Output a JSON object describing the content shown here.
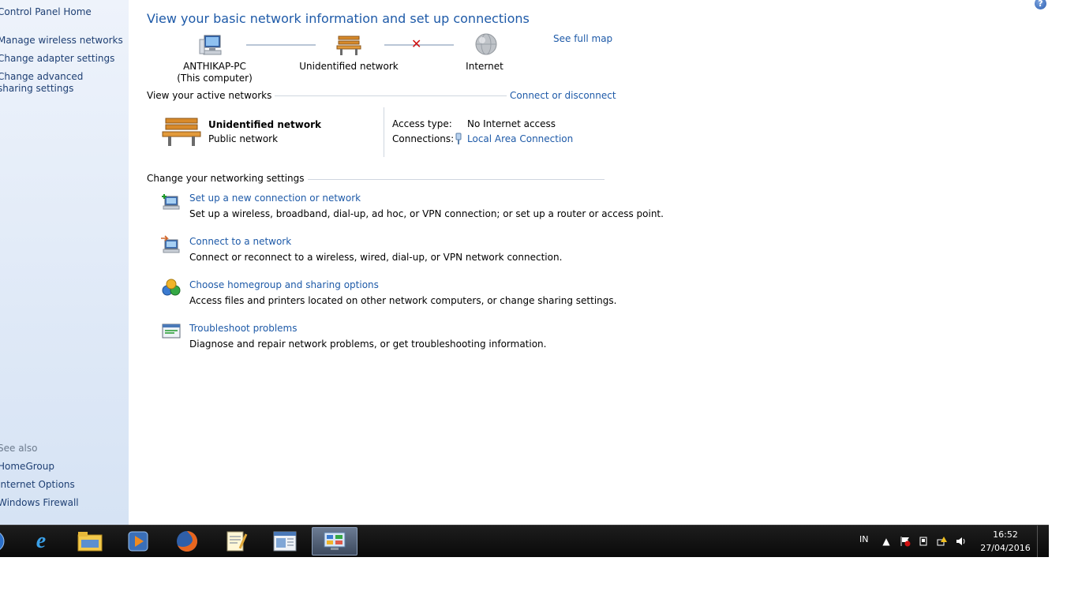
{
  "sidebar": {
    "home": "Control Panel Home",
    "items": [
      "Manage wireless networks",
      "Change adapter settings",
      "Change advanced sharing settings"
    ],
    "see_also_heading": "See also",
    "see_also": [
      "HomeGroup",
      "Internet Options",
      "Windows Firewall"
    ]
  },
  "main": {
    "title": "View your basic network information and set up connections",
    "see_full_map": "See full map",
    "map": {
      "computer_name": "ANTHIKAP-PC",
      "computer_sub": "(This computer)",
      "network_name": "Unidentified network",
      "internet": "Internet"
    },
    "active": {
      "heading": "View your active networks",
      "connect_link": "Connect or disconnect",
      "network_name": "Unidentified network",
      "network_type": "Public network",
      "access_type_label": "Access type:",
      "access_type_value": "No Internet access",
      "connections_label": "Connections:",
      "connections_value": "Local Area Connection"
    },
    "settings_heading": "Change your networking settings",
    "tasks": [
      {
        "title": "Set up a new connection or network",
        "desc": "Set up a wireless, broadband, dial-up, ad hoc, or VPN connection; or set up a router or access point."
      },
      {
        "title": "Connect to a network",
        "desc": "Connect or reconnect to a wireless, wired, dial-up, or VPN network connection."
      },
      {
        "title": "Choose homegroup and sharing options",
        "desc": "Access files and printers located on other network computers, or change sharing settings."
      },
      {
        "title": "Troubleshoot problems",
        "desc": "Diagnose and repair network problems, or get troubleshooting information."
      }
    ]
  },
  "taskbar": {
    "apps": [
      "start-orb-icon",
      "internet-explorer-icon",
      "file-explorer-icon",
      "media-player-icon",
      "firefox-icon",
      "notepad-icon",
      "window-app-icon",
      "control-panel-icon"
    ],
    "lang": "IN",
    "time": "16:52",
    "date": "27/04/2016"
  },
  "colors": {
    "link": "#1e5aa8",
    "sidebar_bg": "#dfe9f7",
    "taskbar_bg": "#111111"
  }
}
